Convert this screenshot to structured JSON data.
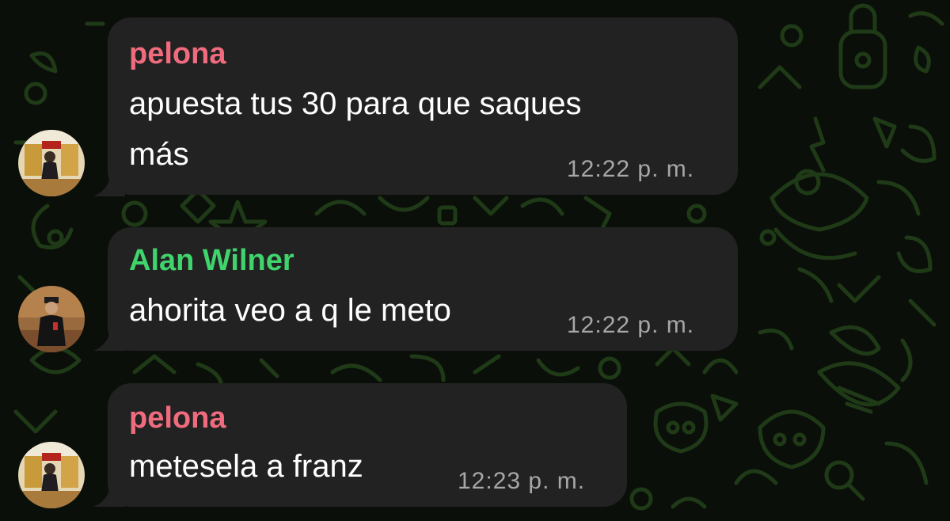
{
  "colors": {
    "background": "#0b0f0a",
    "wallpaper_doodle": "#1f3a16",
    "bubble": "#222222",
    "message_text": "#ffffff",
    "timestamp": "#a7a7a7"
  },
  "messages": [
    {
      "sender": "pelona",
      "sender_color": "#f06b7d",
      "lines": [
        "apuesta tus 30 para que saques",
        "más"
      ],
      "time": "12:22 p. m.",
      "avatar": "pelona-avatar"
    },
    {
      "sender": "Alan Wilner",
      "sender_color": "#3fd46c",
      "lines": [
        "ahorita veo a q le meto"
      ],
      "time": "12:22 p. m.",
      "avatar": "alan-wilner-avatar"
    },
    {
      "sender": "pelona",
      "sender_color": "#f06b7d",
      "lines": [
        "metesela a franz"
      ],
      "time": "12:23 p. m.",
      "avatar": "pelona-avatar"
    }
  ]
}
